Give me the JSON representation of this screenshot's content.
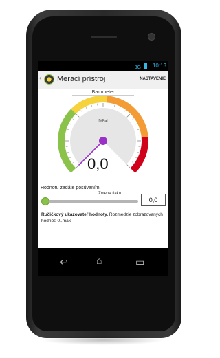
{
  "statusbar": {
    "signal": "3G",
    "time": "10:13"
  },
  "actionbar": {
    "title": "Merací prístroj",
    "settings_label": "NASTAVENIE"
  },
  "gauge": {
    "title": "Barometer",
    "unit": "[MPa]",
    "value_display": "0,0",
    "colors": {
      "green": "#8bc34a",
      "yellow": "#f6d33c",
      "orange": "#f39c35",
      "red": "#d0021b",
      "needle": "#9b30c8"
    },
    "needle_fraction": 0.0
  },
  "controls": {
    "hint": "Hodnotu zadáte posúvaním",
    "slider_label": "Zmena tlaku",
    "input_value": "0,0",
    "slider_fraction": 0.0
  },
  "description": {
    "bold": "Ručičkový ukazovateľ hodnoty.",
    "rest": " Rozmedzie zobrazovaných hodnôt: 0..max"
  },
  "navbar": {
    "back": "back-icon",
    "home": "home-icon",
    "recents": "recents-icon"
  }
}
